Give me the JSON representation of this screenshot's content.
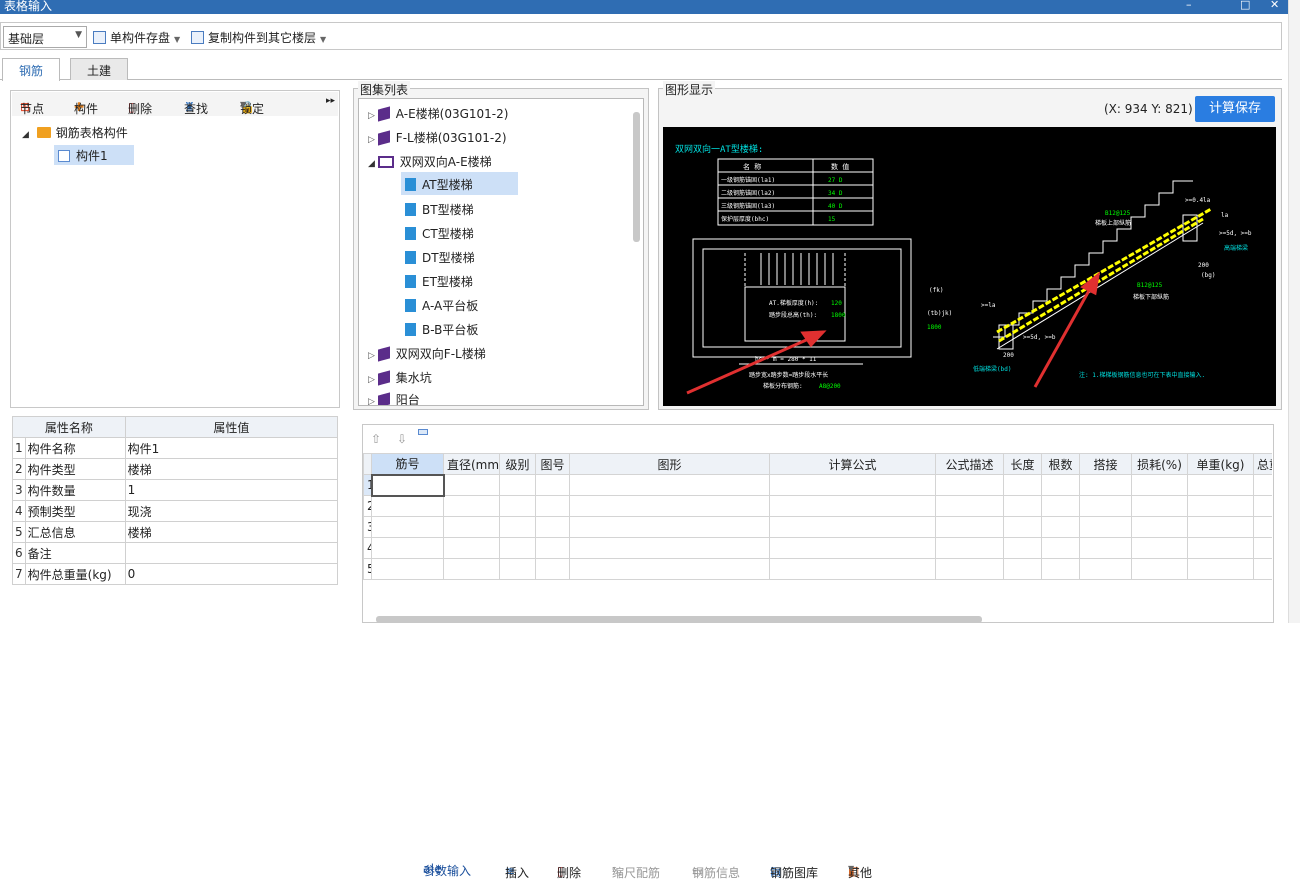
{
  "window": {
    "title": "表格输入",
    "min": "–",
    "max": "□",
    "close": "✕"
  },
  "toolbar": {
    "floor": "基础层",
    "save_component": "单构件存盘",
    "copy_to_floor": "复制构件到其它楼层"
  },
  "tabs": [
    "钢筋",
    "土建"
  ],
  "left_toolbar": {
    "node": "节点",
    "component": "构件",
    "delete": "删除",
    "find": "查找",
    "lock": "锁定",
    "more": "▸▸"
  },
  "left_tree": {
    "root": "钢筋表格构件",
    "child": "构件1"
  },
  "properties": {
    "headers": [
      "属性名称",
      "属性值"
    ],
    "rows": [
      {
        "num": "1",
        "name": "构件名称",
        "value": "构件1"
      },
      {
        "num": "2",
        "name": "构件类型",
        "value": "楼梯"
      },
      {
        "num": "3",
        "name": "构件数量",
        "value": "1"
      },
      {
        "num": "4",
        "name": "预制类型",
        "value": "现浇"
      },
      {
        "num": "5",
        "name": "汇总信息",
        "value": "楼梯"
      },
      {
        "num": "6",
        "name": "备注",
        "value": ""
      },
      {
        "num": "7",
        "name": "构件总重量(kg)",
        "value": "0"
      }
    ]
  },
  "atlas": {
    "title": "图集列表",
    "items": [
      {
        "label": "A-E楼梯(03G101-2)"
      },
      {
        "label": "F-L楼梯(03G101-2)"
      },
      {
        "label": "双网双向A-E楼梯"
      },
      {
        "label": "AT型楼梯"
      },
      {
        "label": "BT型楼梯"
      },
      {
        "label": "CT型楼梯"
      },
      {
        "label": "DT型楼梯"
      },
      {
        "label": "ET型楼梯"
      },
      {
        "label": "A-A平台板"
      },
      {
        "label": "B-B平台板"
      },
      {
        "label": "双网双向F-L楼梯"
      },
      {
        "label": "集水坑"
      },
      {
        "label": "阳台"
      }
    ]
  },
  "figure": {
    "title": "图形显示",
    "coords": "(X: 934 Y: 821)",
    "calc_save": "计算保存",
    "cad": {
      "heading": "双网双向一AT型楼梯:",
      "table_head": [
        "名 称",
        "数 值"
      ],
      "table_rows": [
        [
          "一级钢筋锚固(la1)",
          "27 D"
        ],
        [
          "二级钢筋锚固(la2)",
          "34 D"
        ],
        [
          "三级钢筋锚固(la3)",
          "40 D"
        ],
        [
          "保护层厚度(bhc)",
          "15"
        ]
      ],
      "plate_thk": "AT.梯板厚度(h):",
      "plate_thk_val": "120",
      "step_h": "踏步段总高(th):",
      "step_h_val": "1800",
      "formula": "踏步宽x踏步数=踏步段水平长",
      "dist": "梯板分布钢筋:",
      "dist_val": "A8@200",
      "bsm": "bs * m = 280 * 11",
      "top_bar": "B12@125",
      "top_label": "梯板上部纵筋",
      "bot_bar": "B12@125",
      "bot_label": "梯板下部纵筋",
      "high_beam": "高端梯梁",
      "low_beam": "低端梯梁(bd)",
      "note": "注: 1.梯梯板钢筋信息也可在下表中直接输入.",
      "dim200a": "200",
      "dim200b": "200",
      "bg": "(bg)",
      "fk": "(fk)",
      "tbjk": "(tb)jk)",
      "v1800": "1800",
      "geq5d": ">=5d, >=b",
      "geq5d2": ">=5d, >=b",
      "geqla": ">=la",
      "geq04": ">=0.4la",
      "la": "la"
    }
  },
  "bottom_toolbar": {
    "param_input": "参数输入",
    "insert": "插入",
    "delete": "删除",
    "scale": "缩尺配筋",
    "rebar_info": "钢筋信息",
    "rebar_lib": "钢筋图库",
    "other": "其他"
  },
  "grid": {
    "headers": [
      "筋号",
      "直径(mm)",
      "级别",
      "图号",
      "图形",
      "计算公式",
      "公式描述",
      "长度",
      "根数",
      "搭接",
      "损耗(%)",
      "单重(kg)",
      "总重"
    ],
    "rows": [
      "1",
      "2",
      "3",
      "4",
      "5"
    ]
  }
}
